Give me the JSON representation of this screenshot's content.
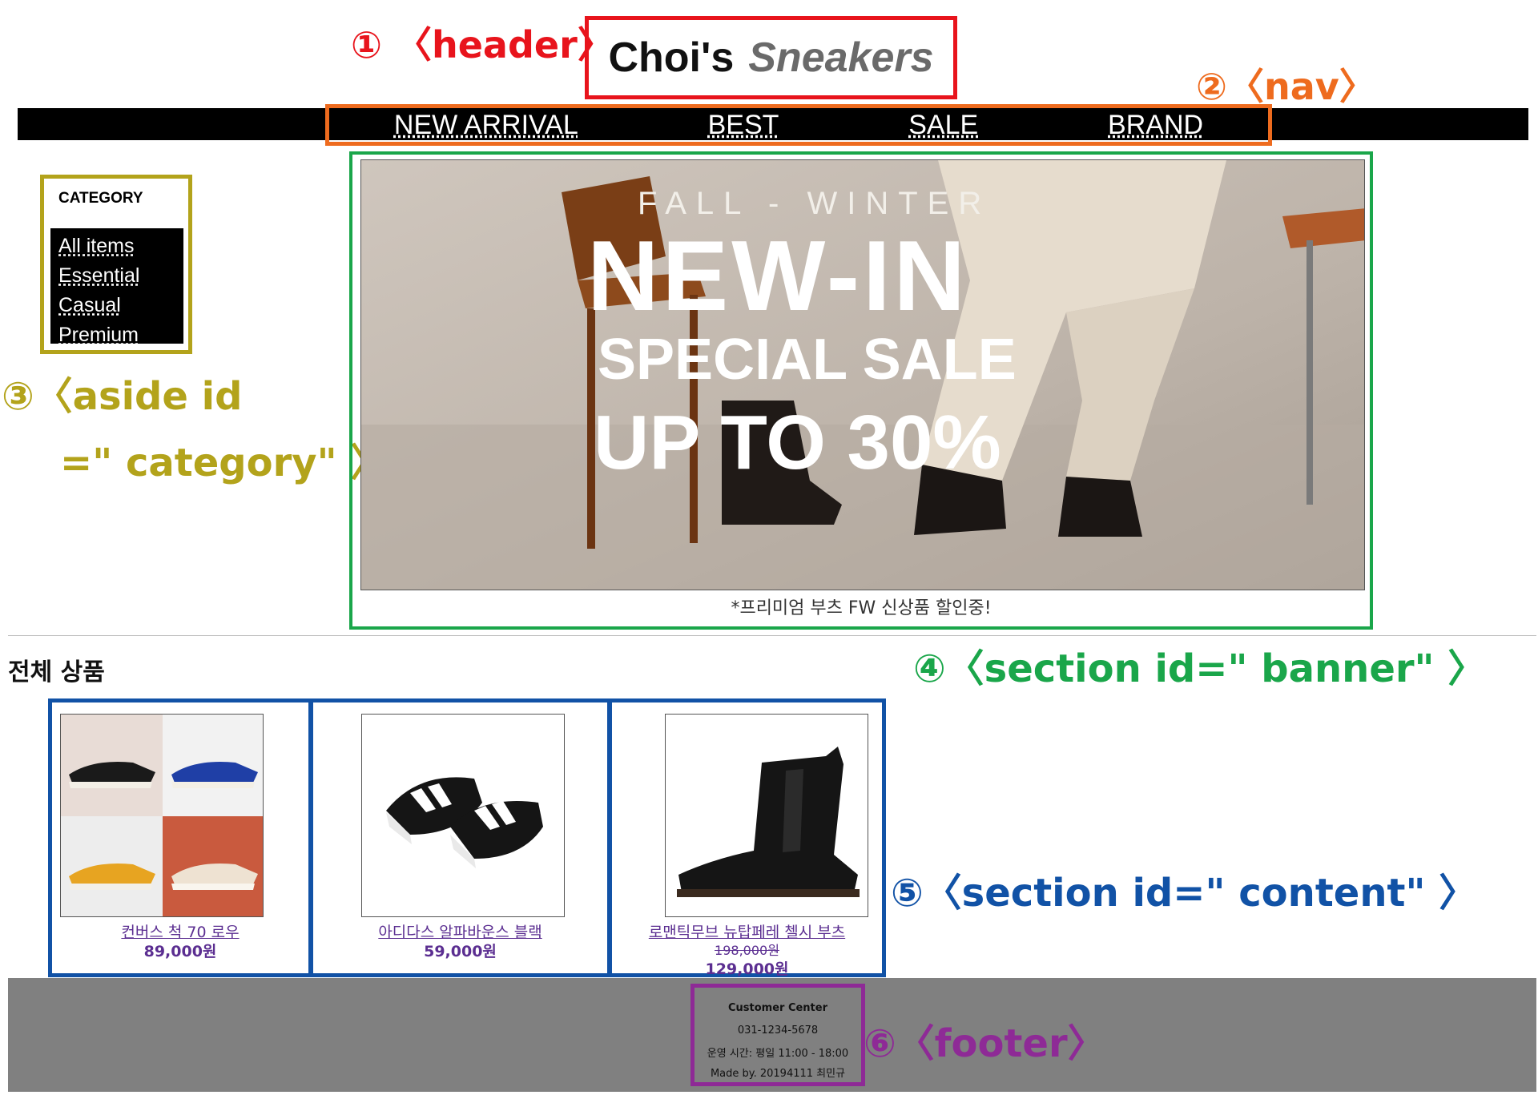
{
  "annotations": {
    "header": "① 〈header〉",
    "nav": "②〈nav〉",
    "aside_line1": "③〈aside id",
    "aside_line2": "=\" category\" 〉",
    "banner": "④〈section id=\" banner\" 〉",
    "content": "⑤〈section id=\" content\" 〉",
    "footer": "⑥〈footer〉"
  },
  "header": {
    "logo_main": "Choi's",
    "logo_sub": "Sneakers"
  },
  "nav": {
    "items": [
      "NEW ARRIVAL",
      "BEST",
      "SALE",
      "BRAND"
    ]
  },
  "category": {
    "title": "CATEGORY",
    "items": [
      "All items",
      "Essential",
      "Casual",
      "Premium"
    ]
  },
  "banner": {
    "kicker": "FALL - WINTER",
    "headline": "NEW-IN",
    "subhead": "SPECIAL SALE",
    "discount": "UP TO 30%",
    "caption": "*프리미엄 부츠 FW 신상품 할인중!"
  },
  "content": {
    "heading": "전체 상품",
    "products": [
      {
        "name": "컨버스 척 70 로우",
        "price": "89,000원"
      },
      {
        "name": "아디다스 알파바운스 블랙",
        "price": "59,000원"
      },
      {
        "name": "로맨틱무브 뉴탑페레 첼시 부츠",
        "original_price": "198,000원",
        "price": "129,000원"
      }
    ]
  },
  "footer": {
    "title": "Customer Center",
    "phone": "031-1234-5678",
    "hours": "운영 시간: 평일 11:00 - 18:00",
    "made_by": "Made by. 20194111 최민규"
  },
  "colors": {
    "header_annotation": "#e8141c",
    "nav_annotation": "#ee6b1e",
    "aside_annotation": "#b3a31b",
    "banner_annotation": "#1aa64a",
    "content_annotation": "#1152a6",
    "footer_annotation": "#8e2a96",
    "link": "#5b2e91",
    "footer_bg": "#808080"
  }
}
